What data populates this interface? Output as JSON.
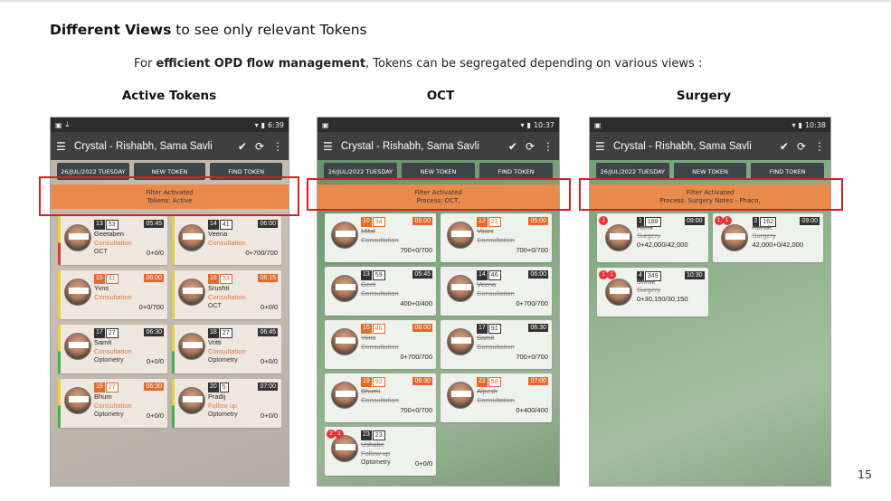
{
  "slide": {
    "heading_bold": "Different Views",
    "heading_rest": " to see only relevant Tokens",
    "sub_prefix": "For ",
    "sub_bold": "efficient OPD flow management",
    "sub_rest": ", Tokens can be segregated depending on various views :",
    "page_number": "15"
  },
  "columns": [
    {
      "title": "Active Tokens"
    },
    {
      "title": "OCT"
    },
    {
      "title": "Surgery"
    }
  ],
  "phones": [
    {
      "status_time": "6:39",
      "app_title": "Crystal - Rishabh, Sama Savli",
      "buttons": [
        "26/JUL/2022 TUESDAY",
        "NEW TOKEN",
        "FIND TOKEN"
      ],
      "filter_line1": "Filter Activated",
      "filter_line2": "Tokens: Active",
      "cards": [
        {
          "t1": "13",
          "t2": "53",
          "time": "05:45",
          "name": "Geetaben",
          "proc": "Consultation",
          "dept": "OCT",
          "amt": "0+0/0",
          "bar": "#e8d23a",
          "bar2": "#d93a3a",
          "orange": false
        },
        {
          "t1": "14",
          "t2": "41",
          "time": "06:00",
          "name": "Veena",
          "proc": "Consultation",
          "dept": "",
          "amt": "0+700/700",
          "bar": "#e8d23a",
          "orange": false
        },
        {
          "t1": "15",
          "t2": "41",
          "time": "06:00",
          "name": "Yvns",
          "proc": "Consultation",
          "dept": "",
          "amt": "0+0/700",
          "bar": "#e8d23a",
          "orange": true
        },
        {
          "t1": "16",
          "t2": "33",
          "time": "06:15",
          "name": "Srushti",
          "proc": "Consultation",
          "dept": "OCT",
          "amt": "0+0/0",
          "bar": "#e8d23a",
          "orange": true
        },
        {
          "t1": "17",
          "t2": "27",
          "time": "06:30",
          "name": "Samit",
          "proc": "Consultation",
          "dept": "Optometry",
          "amt": "0+0/0",
          "bar": "#e8d23a",
          "bar2": "#3bb54a",
          "orange": false
        },
        {
          "t1": "18",
          "t2": "27",
          "time": "06:45",
          "name": "Vritti",
          "proc": "Consultation",
          "dept": "Optometry",
          "amt": "0+0/0",
          "bar": "#e8d23a",
          "bar2": "#3bb54a",
          "orange": false
        },
        {
          "t1": "19",
          "t2": "27",
          "time": "06:30",
          "name": "Bhum",
          "proc": "Consultation",
          "dept": "Optometry",
          "amt": "0+0/0",
          "bar": "#e8d23a",
          "bar2": "#3bb54a",
          "orange": true
        },
        {
          "t1": "20",
          "t2": "5",
          "time": "07:00",
          "name": "Pradij",
          "proc": "Follow up",
          "dept": "Optometry",
          "amt": "0+0/0",
          "bar": "#e8d23a",
          "bar2": "#3bb54a",
          "orange": false
        }
      ]
    },
    {
      "status_time": "10:37",
      "app_title": "Crystal - Rishabh, Sama Savli",
      "buttons": [
        "26/JUL/2022 TUESDAY",
        "NEW TOKEN",
        "FIND TOKEN"
      ],
      "filter_line1": "Filter Activated",
      "filter_line2": "Process: OCT,",
      "cards": [
        {
          "t1": "10",
          "t2": "34",
          "time": "05:00",
          "name": "Mital",
          "proc": "Consultation",
          "amt": "700+0/700",
          "orange": true
        },
        {
          "t1": "12",
          "t2": "21",
          "time": "05:00",
          "name": "Vaani",
          "proc": "Consultation",
          "amt": "700+0/700",
          "orange": true
        },
        {
          "t1": "13",
          "t2": "59",
          "time": "05:45",
          "name": "Geet",
          "proc": "Consultation",
          "amt": "400+0/400",
          "orange": false
        },
        {
          "t1": "14",
          "t2": "46",
          "time": "06:00",
          "name": "Veena",
          "proc": "Consultation",
          "amt": "0+700/700",
          "orange": false
        },
        {
          "t1": "15",
          "t2": "46",
          "time": "06:00",
          "name": "Yvns",
          "proc": "Consultation",
          "amt": "0+700/700",
          "orange": true
        },
        {
          "t1": "17",
          "t2": "91",
          "time": "06:30",
          "name": "Samit",
          "proc": "Consultation",
          "amt": "700+0/700",
          "orange": false
        },
        {
          "t1": "19",
          "t2": "92",
          "time": "06:30",
          "name": "Bhumi",
          "proc": "Consultation",
          "amt": "700+0/700",
          "orange": true
        },
        {
          "t1": "22",
          "t2": "58",
          "time": "07:00",
          "name": "Alpesh",
          "proc": "Consultation",
          "amt": "0+400/400",
          "orange": true
        },
        {
          "t1": "23",
          "t2": "23",
          "time": "",
          "name": "Ushabe",
          "proc": "Follow up",
          "dept": "Optometry",
          "amt": "0+0/0",
          "orange": false,
          "badges": [
            "2",
            "1"
          ]
        }
      ]
    },
    {
      "status_time": "10:38",
      "app_title": "Crystal - Rishabh, Sama Savli",
      "buttons": [
        "26/JUL/2022 TUESDAY",
        "NEW TOKEN",
        "FIND TOKEN"
      ],
      "filter_line1": "Filter Activated",
      "filter_line2": "Process: Surgery Notes - Phaco,",
      "cards": [
        {
          "t1": "1",
          "t2": "188",
          "time": "09:00",
          "name": "Homi",
          "proc": "Surgery",
          "amt": "0+42,000/42,000",
          "badges": [
            "1"
          ]
        },
        {
          "t1": "2",
          "t2": "162",
          "time": "09:00",
          "name": "Kanak",
          "proc": "Surgery",
          "amt": "42,000+0/42,000",
          "badges": [
            "1",
            "1"
          ]
        },
        {
          "t1": "4",
          "t2": "349",
          "time": "10:30",
          "name": "Dhruti",
          "proc": "Surgery",
          "amt": "0+30,150/30,150",
          "badges": [
            "1",
            "1"
          ]
        }
      ]
    }
  ]
}
